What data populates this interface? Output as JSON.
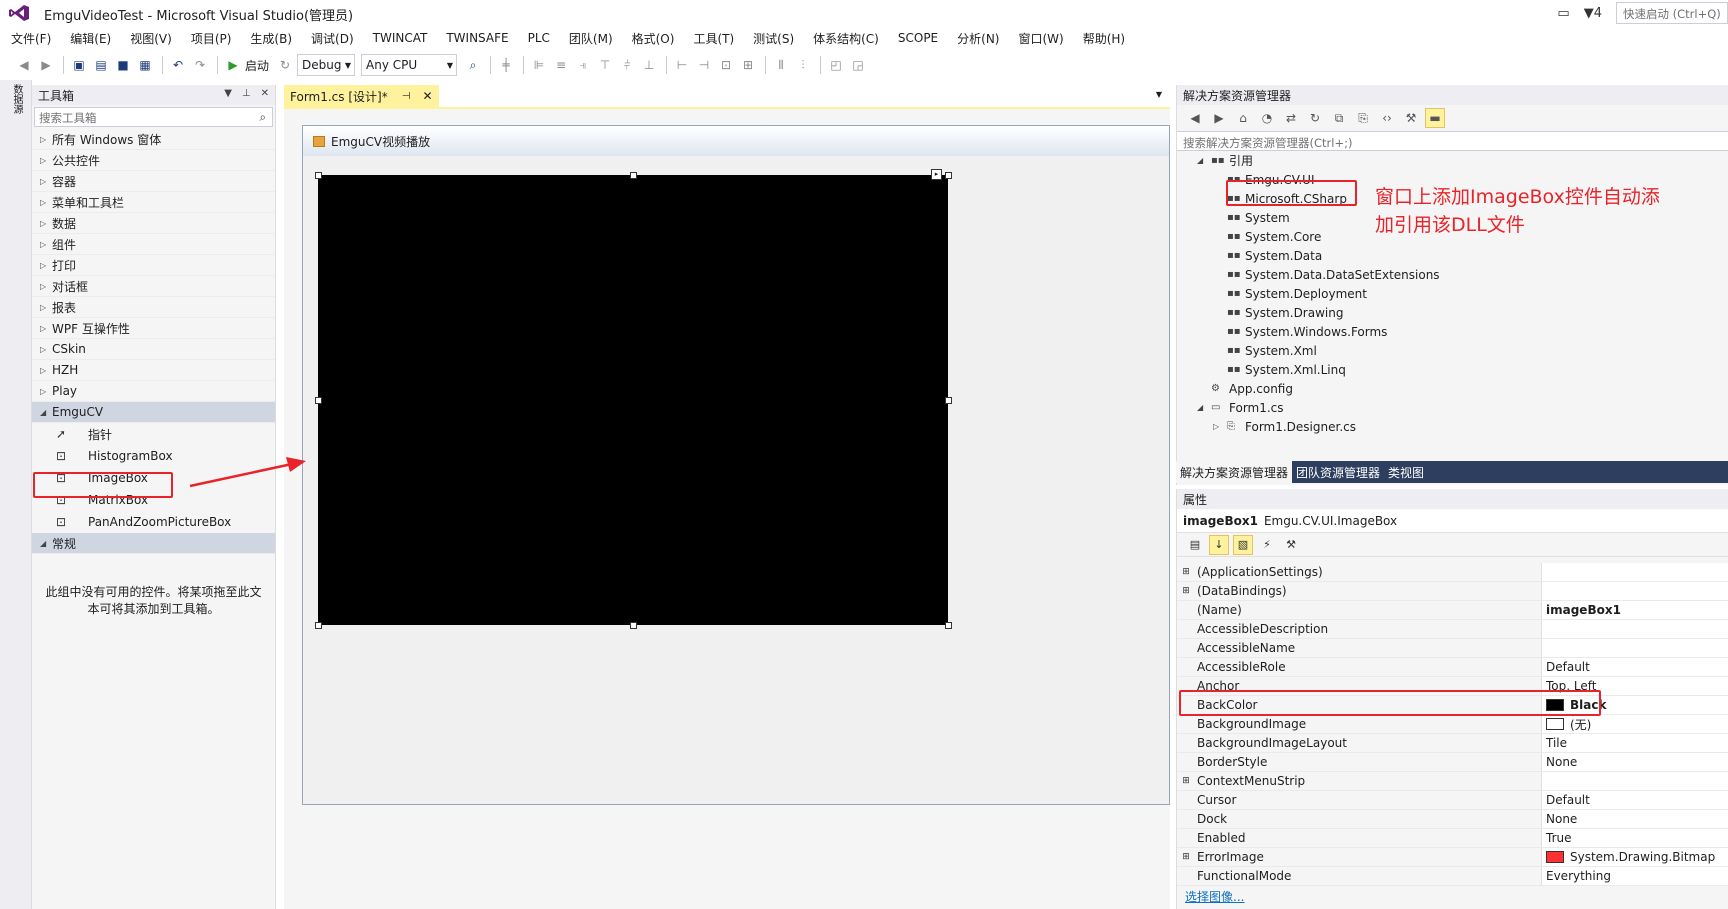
{
  "window": {
    "title": "EmguVideoTest - Microsoft Visual Studio(管理员)",
    "notification_count": "4",
    "quick_launch_placeholder": "快速启动 (Ctrl+Q)"
  },
  "menu": [
    "文件(F)",
    "编辑(E)",
    "视图(V)",
    "项目(P)",
    "生成(B)",
    "调试(D)",
    "TWINCAT",
    "TWINSAFE",
    "PLC",
    "团队(M)",
    "格式(O)",
    "工具(T)",
    "测试(S)",
    "体系结构(C)",
    "SCOPE",
    "分析(N)",
    "窗口(W)",
    "帮助(H)"
  ],
  "toolbar": {
    "start_label": "启动",
    "config": "Debug",
    "platform": "Any CPU"
  },
  "left_strip": {
    "tab": "数据源"
  },
  "toolbox": {
    "title": "工具箱",
    "search_placeholder": "搜索工具箱",
    "groups_before": [
      "所有 Windows 窗体",
      "公共控件",
      "容器",
      "菜单和工具栏",
      "数据",
      "组件",
      "打印",
      "对话框",
      "报表",
      "WPF 互操作性",
      "CSkin",
      "HZH",
      "Play"
    ],
    "open_group": "EmguCV",
    "tools": [
      "指针",
      "HistogramBox",
      "ImageBox",
      "MatrixBox",
      "PanAndZoomPictureBox"
    ],
    "last_group": "常规",
    "empty_message": "此组中没有可用的控件。将某项拖至此文本可将其添加到工具箱。"
  },
  "document": {
    "tab_label": "Form1.cs [设计]*",
    "form_title": "EmguCV视频播放"
  },
  "solution_explorer": {
    "title": "解决方案资源管理器",
    "search_placeholder": "搜索解决方案资源管理器(Ctrl+;)",
    "references_label": "引用",
    "references": [
      "Emgu.CV.UI",
      "Microsoft.CSharp",
      "System",
      "System.Core",
      "System.Data",
      "System.Data.DataSetExtensions",
      "System.Deployment",
      "System.Drawing",
      "System.Windows.Forms",
      "System.Xml",
      "System.Xml.Linq"
    ],
    "app_config": "App.config",
    "form1": "Form1.cs",
    "form1_designer": "Form1.Designer.cs",
    "tabs": [
      "解决方案资源管理器",
      "团队资源管理器",
      "类视图"
    ]
  },
  "properties": {
    "title": "属性",
    "object_name": "imageBox1",
    "object_type": "Emgu.CV.UI.ImageBox",
    "rows": [
      {
        "name": "(ApplicationSettings)",
        "value": "",
        "expandable": true
      },
      {
        "name": "(DataBindings)",
        "value": "",
        "expandable": true
      },
      {
        "name": "(Name)",
        "value": "imageBox1",
        "bold": true
      },
      {
        "name": "AccessibleDescription",
        "value": ""
      },
      {
        "name": "AccessibleName",
        "value": ""
      },
      {
        "name": "AccessibleRole",
        "value": "Default"
      },
      {
        "name": "Anchor",
        "value": "Top, Left"
      },
      {
        "name": "BackColor",
        "value": "Black",
        "bold": true,
        "swatch": "#000000"
      },
      {
        "name": "BackgroundImage",
        "value": "(无)",
        "swatch": "#ffffff"
      },
      {
        "name": "BackgroundImageLayout",
        "value": "Tile"
      },
      {
        "name": "BorderStyle",
        "value": "None"
      },
      {
        "name": "ContextMenuStrip",
        "value": "",
        "expandable": true
      },
      {
        "name": "Cursor",
        "value": "Default"
      },
      {
        "name": "Dock",
        "value": "None"
      },
      {
        "name": "Enabled",
        "value": "True"
      },
      {
        "name": "ErrorImage",
        "value": "System.Drawing.Bitmap",
        "expandable": true,
        "swatch": "#ff3030"
      },
      {
        "name": "FunctionalMode",
        "value": "Everything"
      }
    ],
    "link": "选择图像..."
  },
  "annotation": {
    "text": "窗口上添加ImageBox控件自动添加引用该DLL文件"
  }
}
